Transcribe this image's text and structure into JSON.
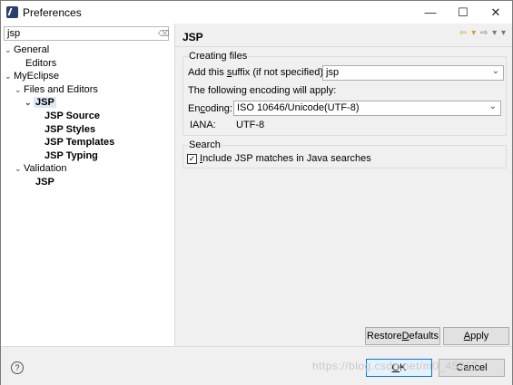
{
  "window": {
    "title": "Preferences",
    "controls": {
      "minimize": "—",
      "maximize": "☐",
      "close": "✕"
    }
  },
  "filter": {
    "value": "jsp"
  },
  "tree": [
    {
      "id": "general",
      "label": "General",
      "twisty": "⌄"
    },
    {
      "id": "editors",
      "label": "Editors"
    },
    {
      "id": "myeclipse",
      "label": "MyEclipse",
      "twisty": "⌄"
    },
    {
      "id": "files-and-editors",
      "label": "Files and Editors",
      "twisty": "⌄"
    },
    {
      "id": "jsp-selected",
      "label": "JSP",
      "twisty": "⌄"
    },
    {
      "id": "jsp-source",
      "label": "JSP Source"
    },
    {
      "id": "jsp-styles",
      "label": "JSP Styles"
    },
    {
      "id": "jsp-templates",
      "label": "JSP Templates"
    },
    {
      "id": "jsp-typing",
      "label": "JSP Typing"
    },
    {
      "id": "validation",
      "label": "Validation",
      "twisty": "⌄"
    },
    {
      "id": "validation-jsp",
      "label": "JSP"
    }
  ],
  "page": {
    "title": "JSP",
    "nav_icons": {
      "back": "⇦ ▾",
      "forward": "⇨ ▾",
      "menu": "▾"
    },
    "creating_files": {
      "group_label": "Creating files",
      "suffix_label_pre": "Add this ",
      "suffix_label_mn": "s",
      "suffix_label_post": "uffix (if not specified):",
      "suffix_value": "jsp",
      "encoding_note": "The following encoding will apply:",
      "encoding_label_pre": "En",
      "encoding_label_mn": "c",
      "encoding_label_post": "oding:",
      "encoding_value": "ISO 10646/Unicode(UTF-8)",
      "iana_label": "IANA:",
      "iana_value": "UTF-8"
    },
    "search": {
      "group_label": "Search",
      "checkbox_checked": true,
      "checkbox_label_mn": "I",
      "checkbox_label_rest": "nclude JSP matches in Java searches"
    },
    "restore_pre": "Restore ",
    "restore_mn": "D",
    "restore_post": "efaults",
    "apply_mn": "A",
    "apply_post": "pply"
  },
  "bottom": {
    "help_icon": "?",
    "ok_mn": "O",
    "ok_post": "K",
    "cancel": "Cancel"
  },
  "watermark": "https://blog.csdn.net/m0_45213"
}
